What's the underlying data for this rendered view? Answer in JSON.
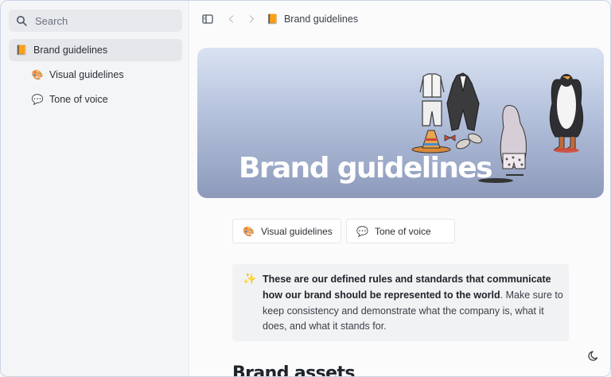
{
  "search": {
    "placeholder": "Search",
    "icon": "search-icon"
  },
  "sidebar": {
    "items": [
      {
        "emoji": "📙",
        "label": "Brand guidelines",
        "active": true
      },
      {
        "emoji": "🎨",
        "label": "Visual guidelines",
        "active": false
      },
      {
        "emoji": "💬",
        "label": "Tone of voice",
        "active": false
      }
    ]
  },
  "topbar": {
    "toggle_icon": "sidebar-toggle-icon",
    "back_icon": "chevron-left-icon",
    "forward_icon": "chevron-right-icon",
    "breadcrumb": {
      "emoji": "📙",
      "label": "Brand guidelines"
    }
  },
  "hero": {
    "title": "Brand guidelines"
  },
  "chips": [
    {
      "emoji": "🎨",
      "label": "Visual guidelines"
    },
    {
      "emoji": "💬",
      "label": "Tone of voice"
    }
  ],
  "callout": {
    "emoji": "✨",
    "bold": "These are our defined rules and standards that communicate how our brand should be represented to the world",
    "rest": ". Make sure to keep consistency and demonstrate what the company is, what it does, and what it stands for."
  },
  "section": {
    "heading": "Brand assets"
  },
  "theme_toggle_icon": "moon-icon",
  "colors": {
    "accent": "#e7b52c",
    "hero_top": "#d9e2f2",
    "hero_bottom": "#8d9abb"
  }
}
